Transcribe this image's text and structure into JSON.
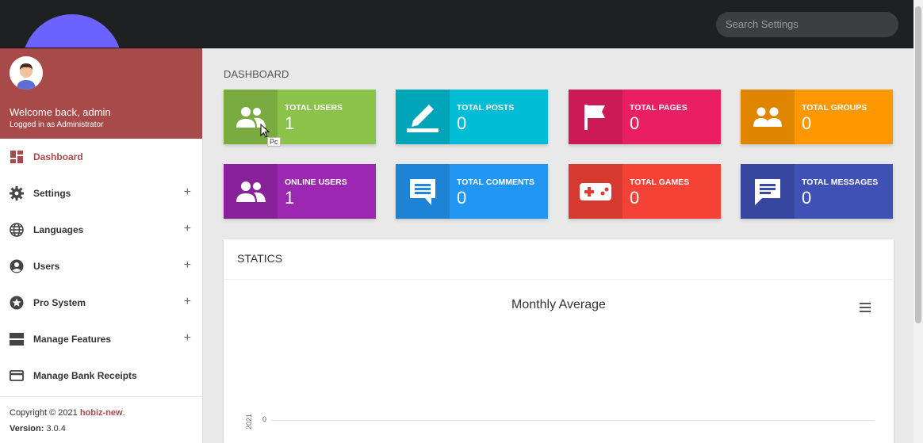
{
  "search": {
    "placeholder": "Search Settings"
  },
  "user": {
    "welcome": "Welcome back, admin",
    "role": "Logged in as Administrator"
  },
  "sidebar": {
    "items": [
      {
        "label": "Dashboard",
        "icon": "dashboard-icon",
        "active": true
      },
      {
        "label": "Settings",
        "icon": "gear-icon",
        "expandable": true
      },
      {
        "label": "Languages",
        "icon": "globe-icon",
        "expandable": true
      },
      {
        "label": "Users",
        "icon": "user-circle-icon",
        "expandable": true
      },
      {
        "label": "Pro System",
        "icon": "star-icon",
        "expandable": true
      },
      {
        "label": "Manage Features",
        "icon": "features-icon",
        "expandable": true
      },
      {
        "label": "Manage Bank Receipts",
        "icon": "credit-card-icon"
      }
    ],
    "expand_symbol": "+"
  },
  "footer": {
    "copyright": "Copyright © 2021 ",
    "site": "hobiz-new",
    "period": ".",
    "version_label": "Version:",
    "version": " 3.0.4"
  },
  "page_title": "DASHBOARD",
  "cards": [
    {
      "label": "TOTAL USERS",
      "value": "1",
      "color": "#8bc34a",
      "icon": "users-icon"
    },
    {
      "label": "TOTAL POSTS",
      "value": "0",
      "color": "#00bcd4",
      "icon": "pencil-icon"
    },
    {
      "label": "TOTAL PAGES",
      "value": "0",
      "color": "#e91e63",
      "icon": "flag-icon"
    },
    {
      "label": "TOTAL GROUPS",
      "value": "0",
      "color": "#ff9800",
      "icon": "group-icon"
    },
    {
      "label": "ONLINE USERS",
      "value": "1",
      "color": "#9c27b0",
      "icon": "users-icon"
    },
    {
      "label": "TOTAL COMMENTS",
      "value": "0",
      "color": "#2196f3",
      "icon": "comment-icon"
    },
    {
      "label": "TOTAL GAMES",
      "value": "0",
      "color": "#f44336",
      "icon": "gamepad-icon"
    },
    {
      "label": "TOTAL MESSAGES",
      "value": "0",
      "color": "#3f51b5",
      "icon": "message-icon"
    }
  ],
  "statics": {
    "title": "STATICS",
    "chart_title": "Monthly Average",
    "y_tick": "0",
    "year_label": "2021"
  },
  "tooltip": "Pc"
}
